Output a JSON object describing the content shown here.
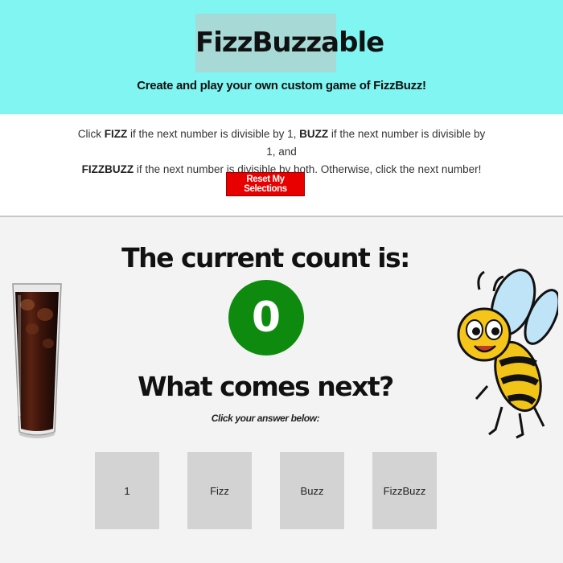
{
  "header": {
    "title": "FizzBuzzable",
    "subtitle": "Create and play your own custom game of FizzBuzz!"
  },
  "rules": {
    "t1": "Click ",
    "fizz": "FIZZ",
    "t2": " if the next number is divisible by 1, ",
    "buzz": "BUZZ",
    "t3": " if the next number is divisible by 1, and",
    "fizzbuzz": "FIZZBUZZ",
    "t4": " if the next number is divisible by both. Otherwise, click the next number!",
    "reset_label": "Reset My Selections"
  },
  "game": {
    "count_heading": "The current count is:",
    "count_value": "0",
    "next_heading": "What comes next?",
    "hint": "Click your answer below:",
    "answers": [
      "1",
      "Fizz",
      "Buzz",
      "FizzBuzz"
    ]
  },
  "images": {
    "left": "soda-glass-image",
    "right": "bee-cartoon-image"
  },
  "colors": {
    "header_bg": "#80f5f2",
    "title_bg": "#a7d9d6",
    "reset_bg": "#e80000",
    "count_bg": "#0e8b0e",
    "answer_bg": "#d3d3d3"
  }
}
